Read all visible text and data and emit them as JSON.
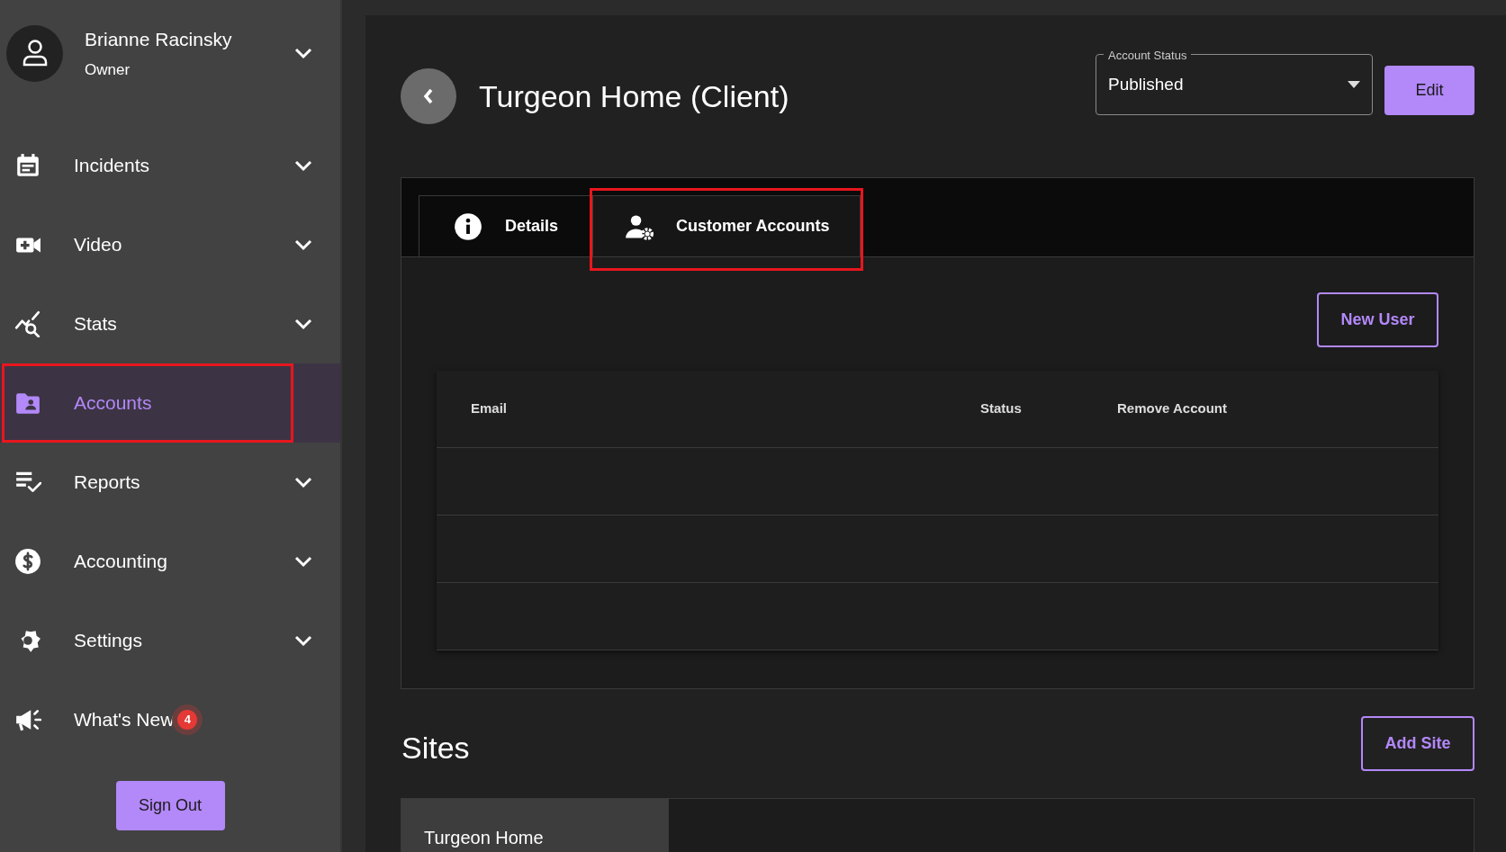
{
  "user": {
    "name": "Brianne Racinsky",
    "role": "Owner"
  },
  "sidebar": {
    "items": [
      {
        "kind": "incidents",
        "label": "Incidents",
        "selected": false,
        "highlighted": false,
        "has_chevron": true
      },
      {
        "kind": "video",
        "label": "Video",
        "selected": false,
        "highlighted": false,
        "has_chevron": true
      },
      {
        "kind": "stats",
        "label": "Stats",
        "selected": false,
        "highlighted": false,
        "has_chevron": true
      },
      {
        "kind": "accounts",
        "label": "Accounts",
        "selected": true,
        "highlighted": true,
        "has_chevron": false
      },
      {
        "kind": "reports",
        "label": "Reports",
        "selected": false,
        "highlighted": false,
        "has_chevron": true
      },
      {
        "kind": "accounting",
        "label": "Accounting",
        "selected": false,
        "highlighted": false,
        "has_chevron": true
      },
      {
        "kind": "settings",
        "label": "Settings",
        "selected": false,
        "highlighted": false,
        "has_chevron": true
      },
      {
        "kind": "news",
        "label": "What's New",
        "selected": false,
        "highlighted": false,
        "has_chevron": false,
        "badge": "4"
      }
    ],
    "sign_out": "Sign Out"
  },
  "header": {
    "title": "Turgeon Home (Client)",
    "account_status": {
      "label": "Account Status",
      "value": "Published"
    },
    "edit": "Edit"
  },
  "tabs": [
    {
      "kind": "info",
      "label": "Details",
      "selected": false,
      "highlighted": false
    },
    {
      "kind": "users",
      "label": "Customer Accounts",
      "selected": true,
      "highlighted": true
    }
  ],
  "new_user": "New User",
  "table": {
    "columns": [
      "Email",
      "Status",
      "Remove Account"
    ]
  },
  "sites": {
    "title": "Sites",
    "add": "Add Site",
    "items": [
      {
        "label": "Turgeon Home",
        "selected": true
      }
    ]
  }
}
